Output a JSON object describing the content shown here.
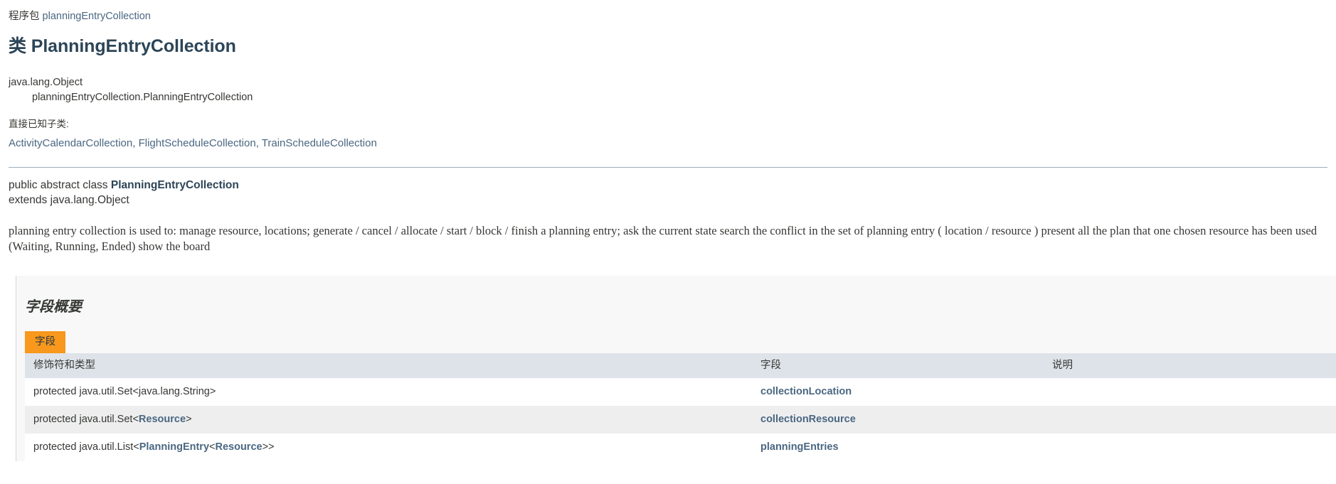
{
  "header": {
    "package_label": "程序包",
    "package_name": "planningEntryCollection",
    "class_kind_label": "类",
    "class_name": "PlanningEntryCollection"
  },
  "inheritance": {
    "super": "java.lang.Object",
    "self": "planningEntryCollection.PlanningEntryCollection"
  },
  "subclasses": {
    "label": "直接已知子类:",
    "items": [
      "ActivityCalendarCollection",
      "FlightScheduleCollection",
      "TrainScheduleCollection"
    ],
    "separator": ", "
  },
  "declaration": {
    "modifiers": "public abstract class ",
    "name": "PlanningEntryCollection",
    "extends": "extends java.lang.Object"
  },
  "description": "planning entry collection is used to: manage resource, locations; generate / cancel / allocate / start / block / finish a planning entry; ask the current state search the conflict in the set of planning entry ( location / resource ) present all the plan that one chosen resource has been used (Waiting, Running, Ended) show the board",
  "field_summary": {
    "heading": "字段概要",
    "tab_label": "字段",
    "columns": {
      "type": "修饰符和类型",
      "field": "字段",
      "description": "说明"
    },
    "rows": [
      {
        "type_prefix": "protected java.util.Set<java.lang.String>",
        "type_link": "",
        "type_suffix": "",
        "field": "collectionLocation",
        "description": ""
      },
      {
        "type_prefix": "protected java.util.Set<",
        "type_link": "Resource",
        "type_suffix": ">",
        "field": "collectionResource",
        "description": ""
      },
      {
        "type_prefix": "protected java.util.List<",
        "type_link": "PlanningEntry",
        "type_link2": "Resource",
        "type_mid": "<",
        "type_suffix": ">>",
        "field": "planningEntries",
        "description": ""
      }
    ]
  },
  "colors": {
    "accent_orange": "#f8981d",
    "link_blue": "#4a6782",
    "title_blue": "#2c4557",
    "table_header_bg": "#dee3e9",
    "row_alt_bg": "#eeeeef",
    "panel_bg": "#f8f8f8",
    "text": "#353833"
  }
}
